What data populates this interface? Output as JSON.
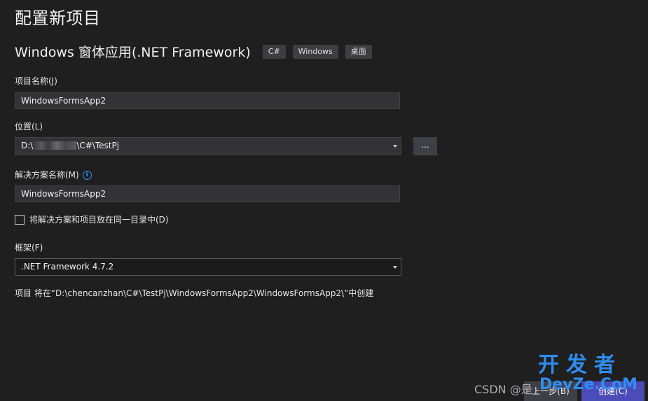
{
  "header": {
    "title": "配置新项目",
    "template_name": "Windows 窗体应用(.NET Framework)",
    "tags": [
      "C#",
      "Windows",
      "桌面"
    ]
  },
  "project_name": {
    "label": "项目名称(J)",
    "value": "WindowsFormsApp2"
  },
  "location": {
    "label": "位置(L)",
    "value_prefix": "D:\\",
    "value_suffix": "\\C#\\TestPj",
    "browse_label": "..."
  },
  "solution_name": {
    "label": "解决方案名称(M)",
    "info_icon": "i",
    "value": "WindowsFormsApp2"
  },
  "same_directory": {
    "label": "将解决方案和项目放在同一目录中(D)",
    "checked": false
  },
  "framework": {
    "label": "框架(F)",
    "value": ".NET Framework 4.7.2"
  },
  "summary": "项目 将在“D:\\chencanzhan\\C#\\TestPj\\WindowsFormsApp2\\WindowsFormsApp2\\”中创建",
  "footer": {
    "back_label": "上一步(B)",
    "create_label": "创建(C)"
  },
  "watermark": {
    "csdn": "CSDN @是",
    "devze_top": "开发者",
    "devze_bottom": "DevZe.CoM"
  },
  "colors": {
    "background": "#1f1f1f",
    "input_bg": "#333337",
    "accent": "#4c4cb8",
    "info_blue": "#3794ff",
    "watermark_blue": "#2f8df2"
  }
}
